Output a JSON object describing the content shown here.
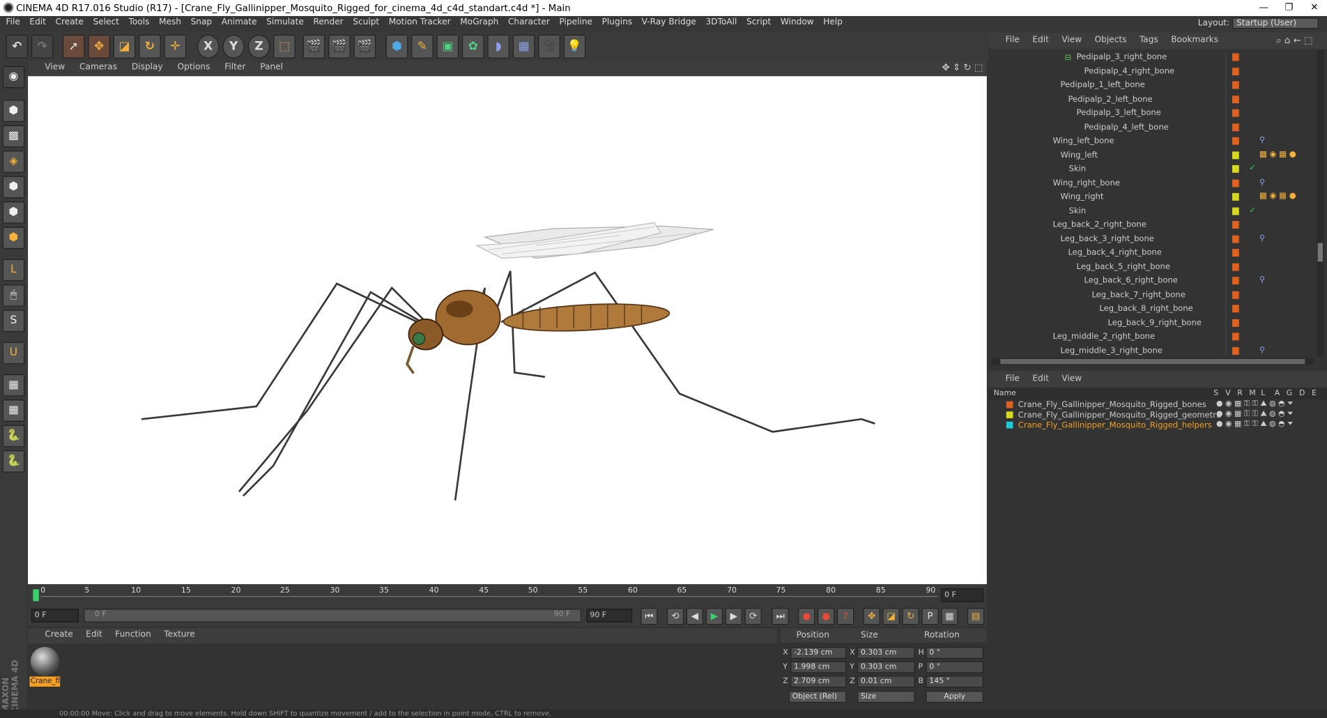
{
  "window": {
    "title": "CINEMA 4D R17.016 Studio (R17) - [Crane_Fly_Gallinipper_Mosquito_Rigged_for_cinema_4d_c4d_standart.c4d *] - Main"
  },
  "menu": [
    "File",
    "Edit",
    "Create",
    "Select",
    "Tools",
    "Mesh",
    "Snap",
    "Animate",
    "Simulate",
    "Render",
    "Sculpt",
    "Motion Tracker",
    "MoGraph",
    "Character",
    "Pipeline",
    "Plugins",
    "V-Ray Bridge",
    "3DToAll",
    "Script",
    "Window",
    "Help"
  ],
  "layout": {
    "label": "Layout:",
    "value": "Startup (User)"
  },
  "viewport": {
    "menu": [
      "View",
      "Cameras",
      "Display",
      "Options",
      "Filter",
      "Panel"
    ]
  },
  "timeline": {
    "ticks": [
      "0",
      "5",
      "10",
      "15",
      "20",
      "25",
      "30",
      "35",
      "40",
      "45",
      "50",
      "55",
      "60",
      "65",
      "70",
      "75",
      "80",
      "85",
      "90"
    ],
    "current_frame": "0 F"
  },
  "playbar": {
    "start": "0 F",
    "slider_start": "0 F",
    "slider_end": "90 F",
    "end": "90 F"
  },
  "materials": {
    "menu": [
      "Create",
      "Edit",
      "Function",
      "Texture"
    ],
    "items": [
      {
        "label": "Crane_fl"
      }
    ]
  },
  "coords": {
    "headers": [
      "Position",
      "Size",
      "Rotation"
    ],
    "rows": [
      {
        "axis": "X",
        "pos": "-2.139 cm",
        "saxis": "X",
        "size": "0.303 cm",
        "raxis": "H",
        "rot": "0 °"
      },
      {
        "axis": "Y",
        "pos": "1.998 cm",
        "saxis": "Y",
        "size": "0.303 cm",
        "raxis": "P",
        "rot": "0 °"
      },
      {
        "axis": "Z",
        "pos": "2.709 cm",
        "saxis": "Z",
        "size": "0.01 cm",
        "raxis": "B",
        "rot": "145 °"
      }
    ],
    "mode": "Object (Rel)",
    "size_mode": "Size",
    "apply": "Apply"
  },
  "objects": {
    "menu": [
      "File",
      "Edit",
      "View",
      "Objects",
      "Tags",
      "Bookmarks"
    ],
    "rows": [
      {
        "label": "Pedipalp_3_right_bone",
        "tag": "#e06020"
      },
      {
        "label": "Pedipalp_4_right_bone",
        "tag": "#e06020"
      },
      {
        "label": "Pedipalp_1_left_bone",
        "tag": "#e06020"
      },
      {
        "label": "Pedipalp_2_left_bone",
        "tag": "#e06020"
      },
      {
        "label": "Pedipalp_3_left_bone",
        "tag": "#e06020"
      },
      {
        "label": "Pedipalp_4_left_bone",
        "tag": "#e06020"
      },
      {
        "label": "Wing_left_bone",
        "tag": "#e06020"
      },
      {
        "label": "Wing_left",
        "tag": "#d8d820"
      },
      {
        "label": "Skin",
        "tag": "#d8d820"
      },
      {
        "label": "Wing_right_bone",
        "tag": "#e06020"
      },
      {
        "label": "Wing_right",
        "tag": "#d8d820"
      },
      {
        "label": "Skin",
        "tag": "#d8d820"
      },
      {
        "label": "Leg_back_2_right_bone",
        "tag": "#e06020"
      },
      {
        "label": "Leg_back_3_right_bone",
        "tag": "#e06020"
      },
      {
        "label": "Leg_back_4_right_bone",
        "tag": "#e06020"
      },
      {
        "label": "Leg_back_5_right_bone",
        "tag": "#e06020"
      },
      {
        "label": "Leg_back_6_right_bone",
        "tag": "#e06020"
      },
      {
        "label": "Leg_back_7_right_bone",
        "tag": "#e06020"
      },
      {
        "label": "Leg_back_8_right_bone",
        "tag": "#e06020"
      },
      {
        "label": "Leg_back_9_right_bone",
        "tag": "#e06020"
      },
      {
        "label": "Leg_middle_2_right_bone",
        "tag": "#e06020"
      },
      {
        "label": "Leg_middle_3_right_bone",
        "tag": "#e06020"
      }
    ]
  },
  "layers": {
    "menu": [
      "File",
      "Edit",
      "View"
    ],
    "columns": [
      "Name",
      "S",
      "V",
      "R",
      "M",
      "L",
      "A",
      "G",
      "D",
      "E"
    ],
    "rows": [
      {
        "label": "Crane_Fly_Gallinipper_Mosquito_Rigged_bones",
        "color": "#e06020"
      },
      {
        "label": "Crane_Fly_Gallinipper_Mosquito_Rigged_geometru",
        "color": "#d8d820"
      },
      {
        "label": "Crane_Fly_Gallinipper_Mosquito_Rigged_helpers",
        "color": "#20c8d8"
      }
    ]
  },
  "status": "00:00:00   Move: Click and drag to move elements. Hold down SHIFT to quantize movement / add to the selection in point mode, CTRL to remove."
}
